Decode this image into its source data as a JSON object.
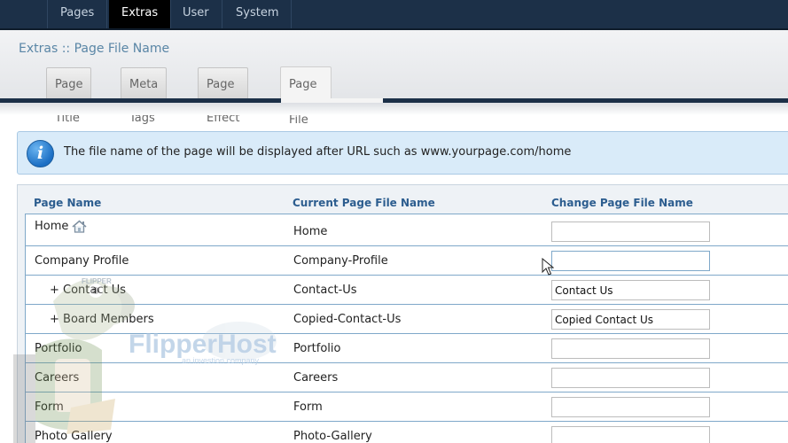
{
  "topnav": {
    "items": [
      "Pages",
      "Extras",
      "User",
      "System"
    ],
    "active": "Extras"
  },
  "breadcrumb": "Extras :: Page File Name",
  "tabs": [
    "Page Title",
    "Meta Tags",
    "Page Effect",
    "Page File Name"
  ],
  "info": {
    "text": "The file name of the page will be displayed after URL such as www.yourpage.com/home"
  },
  "table": {
    "headers": [
      "Page Name",
      "Current Page File Name",
      "Change Page File Name"
    ],
    "rows": [
      {
        "name": "Home",
        "current": "Home",
        "value": ""
      },
      {
        "name": "Company Profile",
        "current": "Company-Profile",
        "value": ""
      },
      {
        "name": "+ Contact Us",
        "current": "Contact-Us",
        "value": "Contact Us"
      },
      {
        "name": "+ Board Members",
        "current": "Copied-Contact-Us",
        "value": "Copied Contact Us"
      },
      {
        "name": "Portfolio",
        "current": "Portfolio",
        "value": ""
      },
      {
        "name": "Careers",
        "current": "Careers",
        "value": ""
      },
      {
        "name": "Form",
        "current": "Form",
        "value": ""
      },
      {
        "name": "Photo Gallery",
        "current": "Photo-Gallery",
        "value": ""
      }
    ]
  },
  "watermark": {
    "brand": "FlipperHost",
    "tagline": "an investion company",
    "badge": "FLIPPER"
  },
  "colors": {
    "nav_bg": "#1c3048",
    "accent_text": "#2c5d8f",
    "info_bg": "#d9ebf9",
    "row_border": "#7fa8c9"
  }
}
